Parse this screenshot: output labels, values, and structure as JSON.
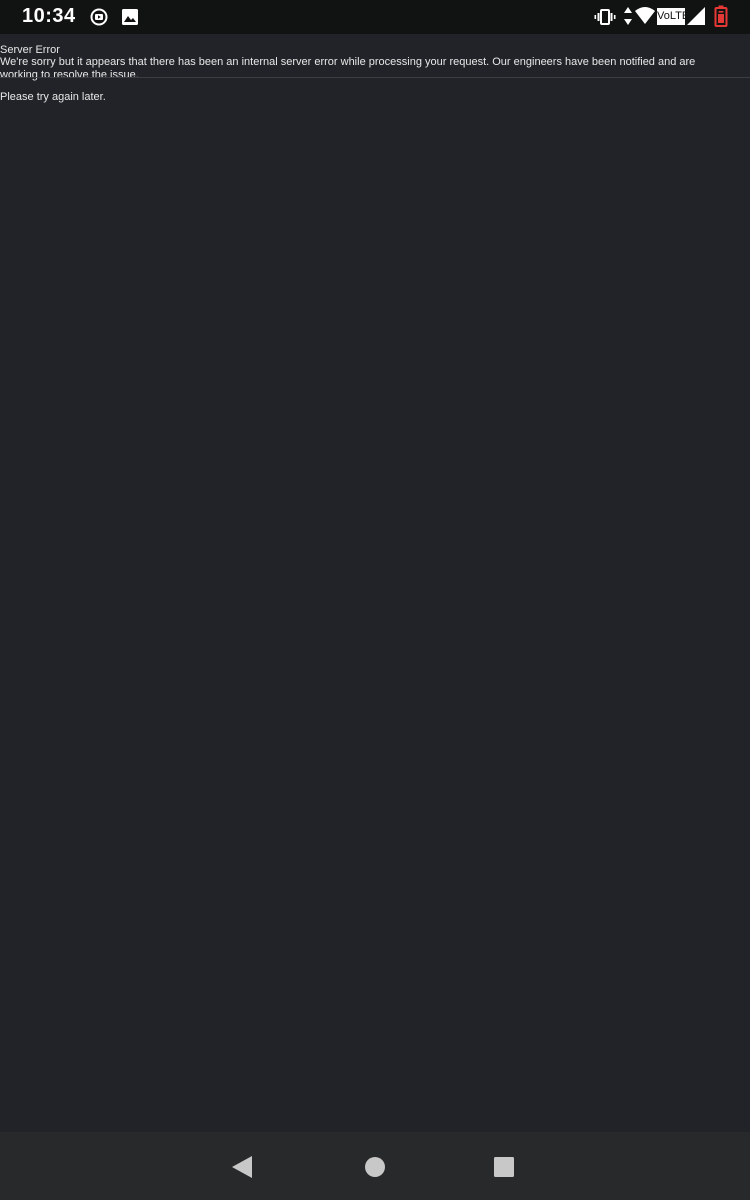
{
  "status_bar": {
    "time": "10:34",
    "network_label": "VoLTE",
    "left_icons": [
      "media-notification-icon",
      "image-notification-icon"
    ],
    "right_icons": [
      "vibrate-icon",
      "data-arrows-icon",
      "wifi-icon",
      "volte-icon",
      "cellular-signal-icon",
      "battery-icon"
    ]
  },
  "page": {
    "title": "Server Error",
    "message": "We're sorry but it appears that there has been an internal server error while processing your request. Our engineers have been notified and are working to resolve the issue.",
    "retry": "Please try again later."
  },
  "nav_bar": {
    "buttons": [
      "back-button",
      "home-button",
      "recents-button"
    ]
  },
  "colors": {
    "background": "#212328",
    "status_bar": "#111313",
    "nav_bar": "#28292b",
    "text": "#e8e8e8",
    "battery_accent": "#e53935"
  }
}
